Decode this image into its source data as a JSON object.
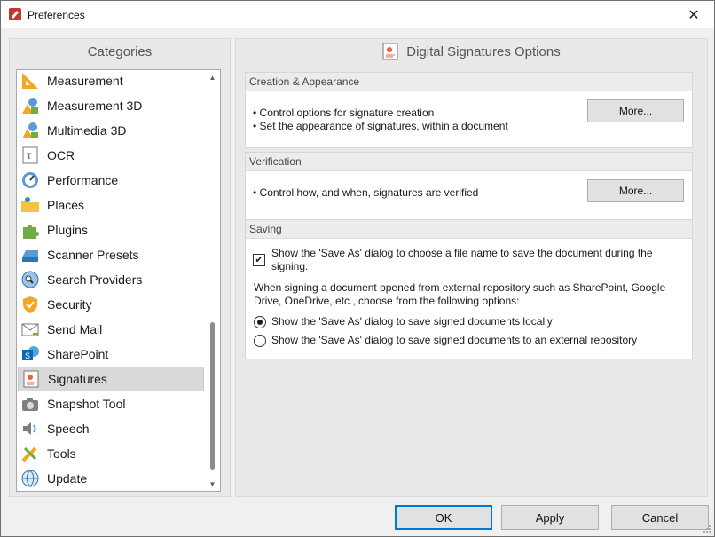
{
  "window": {
    "title": "Preferences",
    "close_glyph": "✕"
  },
  "categories": {
    "header": "Categories",
    "items": [
      {
        "label": "Measurement",
        "icon": "ruler-triangle-icon"
      },
      {
        "label": "Measurement 3D",
        "icon": "3d-shapes-icon"
      },
      {
        "label": "Multimedia 3D",
        "icon": "3d-multimedia-icon"
      },
      {
        "label": "OCR",
        "icon": "ocr-text-icon"
      },
      {
        "label": "Performance",
        "icon": "speedometer-icon"
      },
      {
        "label": "Places",
        "icon": "folder-location-icon"
      },
      {
        "label": "Plugins",
        "icon": "puzzle-piece-icon"
      },
      {
        "label": "Scanner Presets",
        "icon": "scanner-icon"
      },
      {
        "label": "Search Providers",
        "icon": "search-globe-icon"
      },
      {
        "label": "Security",
        "icon": "shield-icon"
      },
      {
        "label": "Send Mail",
        "icon": "envelope-icon"
      },
      {
        "label": "SharePoint",
        "icon": "sharepoint-icon"
      },
      {
        "label": "Signatures",
        "icon": "certificate-icon"
      },
      {
        "label": "Snapshot Tool",
        "icon": "camera-icon"
      },
      {
        "label": "Speech",
        "icon": "speaker-icon"
      },
      {
        "label": "Tools",
        "icon": "tools-icon"
      },
      {
        "label": "Update",
        "icon": "globe-update-icon"
      }
    ],
    "selected": "Signatures"
  },
  "options": {
    "header": "Digital Signatures Options",
    "creation": {
      "title": "Creation & Appearance",
      "bullets": [
        "• Control options for signature creation",
        "• Set the appearance of signatures, within a document"
      ],
      "button": "More..."
    },
    "verification": {
      "title": "Verification",
      "bullets": [
        "• Control how, and when, signatures are verified"
      ],
      "button": "More..."
    },
    "saving": {
      "title": "Saving",
      "checkbox_line1": "Show the 'Save As' dialog to choose a file name to save the document during the",
      "checkbox_line2": "signing.",
      "checkbox_checked": true,
      "note_line1": "When signing a document opened from external repository such as SharePoint, Google",
      "note_line2": "Drive, OneDrive, etc., choose from the following options:",
      "radio_local": "Show the 'Save As' dialog to save signed documents locally",
      "radio_external": "Show the 'Save As' dialog to save signed documents to an external repository",
      "selected_radio": "local"
    }
  },
  "footer": {
    "ok": "OK",
    "apply": "Apply",
    "cancel": "Cancel"
  },
  "colors": {
    "accent": "#0078d7",
    "selected_bg": "#d9d9d9",
    "panel_bg": "#e9e9e9",
    "pdf_red": "#c0392b"
  }
}
